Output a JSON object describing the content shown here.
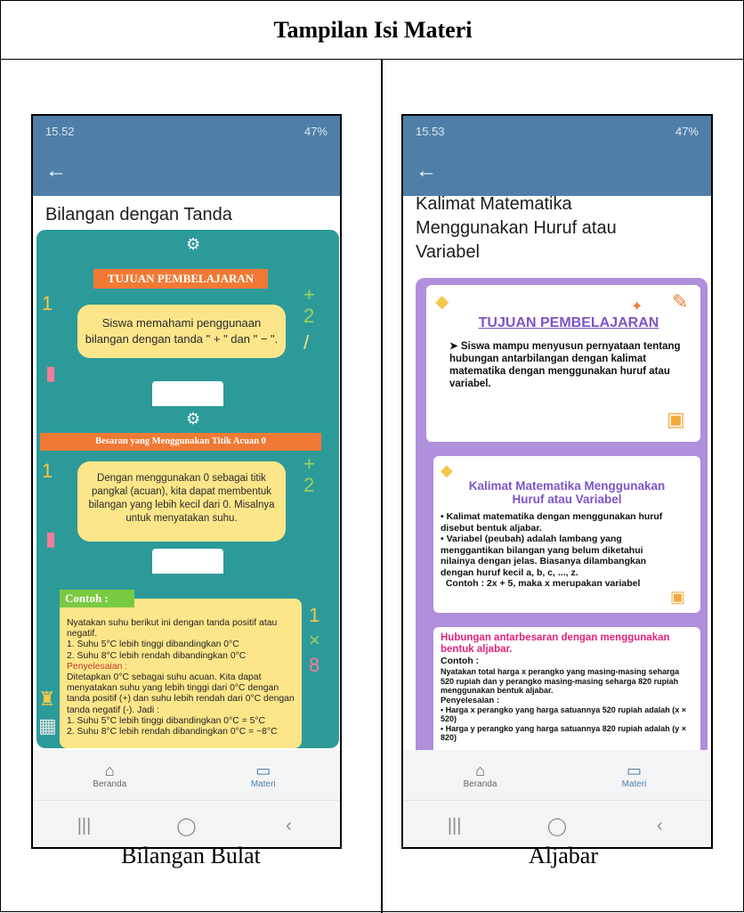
{
  "table": {
    "header": "Tampilan Isi Materi",
    "captions": [
      "Bilangan Bulat",
      "Aljabar"
    ]
  },
  "left_phone": {
    "status_time": "15.52",
    "status_right": "47%",
    "page_title": "Bilangan dengan Tanda",
    "tujuan_label": "TUJUAN PEMBELAJARAN",
    "tujuan_text": "Siswa memahami penggunaan bilangan dengan tanda \" + \" dan \" − \".",
    "besaran_label": "Besaran yang Menggunakan Titik Acuan 0",
    "besaran_text": "Dengan menggunakan 0 sebagai titik pangkal (acuan), kita dapat membentuk bilangan yang lebih kecil dari 0. Misalnya untuk menyatakan suhu.",
    "contoh_label": "Contoh :",
    "contoh_lines": [
      "Nyatakan suhu berikut ini dengan tanda positif atau negatif.",
      "1.  Suhu 5°C lebih tinggi dibandingkan 0°C",
      "2.  Suhu 8°C lebih rendah dibandingkan 0°C",
      "Penyelesaian :",
      "Ditetapkan 0°C sebagai suhu acuan. Kita dapat menyatakan suhu yang lebih tinggi dari 0°C dengan tanda positif (+) dan suhu lebih rendah dari 0°C dengan tanda negatif (-). Jadi :",
      "1.  Suhu 5°C lebih tinggi dibandingkan 0°C = 5°C",
      "2.  Suhu 8°C lebih rendah dibandingkan 0°C = −8°C"
    ],
    "nav": [
      "Beranda",
      "Materi"
    ]
  },
  "right_phone": {
    "status_time": "15.53",
    "status_right": "47%",
    "page_title": "Kalimat Matematika Menggunakan Huruf atau Variabel",
    "tujuan_label": "TUJUAN PEMBELAJARAN",
    "tujuan_text": "Siswa mampu menyusun pernyataan tentang hubungan antarbilangan dengan kalimat matematika dengan menggunakan huruf atau variabel.",
    "kalimat_title": "Kalimat Matematika Menggunakan Huruf atau Variabel",
    "kalimat_bullets": [
      "Kalimat matematika dengan menggunakan huruf disebut bentuk aljabar.",
      "Variabel (peubah) adalah lambang yang menggantikan bilangan yang belum diketahui nilainya dengan jelas. Biasanya dilambangkan dengan huruf kecil a, b, c, ..., z.",
      "Contoh : 2x + 5, maka x merupakan variabel"
    ],
    "hubungan_title": "Hubungan antarbesaran dengan menggunakan bentuk aljabar.",
    "hubungan_contoh": "Contoh :",
    "hubungan_text": "Nyatakan total harga x perangko yang masing-masing seharga 520 rupiah dan y perangko masing-masing seharga 820 rupiah menggunakan bentuk aljabar.",
    "hubungan_penyelesaian": "Penyelesaian :",
    "hubungan_bullets": [
      "Harga x perangko yang harga satuannya 520 rupiah adalah (x × 520)",
      "Harga y perangko yang harga satuannya 820 rupiah adalah (y × 820)"
    ],
    "nav": [
      "Beranda",
      "Materi"
    ]
  }
}
